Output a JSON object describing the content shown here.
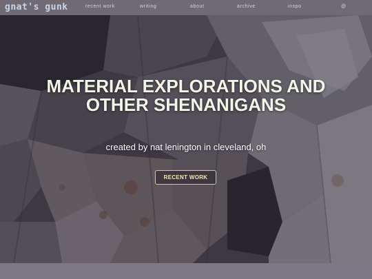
{
  "site": {
    "logo": "gnat's gunk"
  },
  "nav": {
    "items": [
      {
        "label": "recent work"
      },
      {
        "label": "writing"
      },
      {
        "label": "about"
      },
      {
        "label": "archive"
      },
      {
        "label": "inspo"
      },
      {
        "label": "@"
      }
    ]
  },
  "hero": {
    "headline_line1": "MATERIAL EXPLORATIONS AND",
    "headline_line2": "OTHER SHENANIGANS",
    "subtitle": "created by nat lenington in cleveland, oh",
    "cta_label": "RECENT WORK",
    "background_image": "draped patchwork fabric installation"
  },
  "colors": {
    "topbar": "#6f6a74",
    "logo": "#c9d6ee",
    "nav_text": "#d9d4e6",
    "headline": "#f2f5e8",
    "cta_border": "#d9c98a",
    "cta_text": "#f3e7b0"
  }
}
